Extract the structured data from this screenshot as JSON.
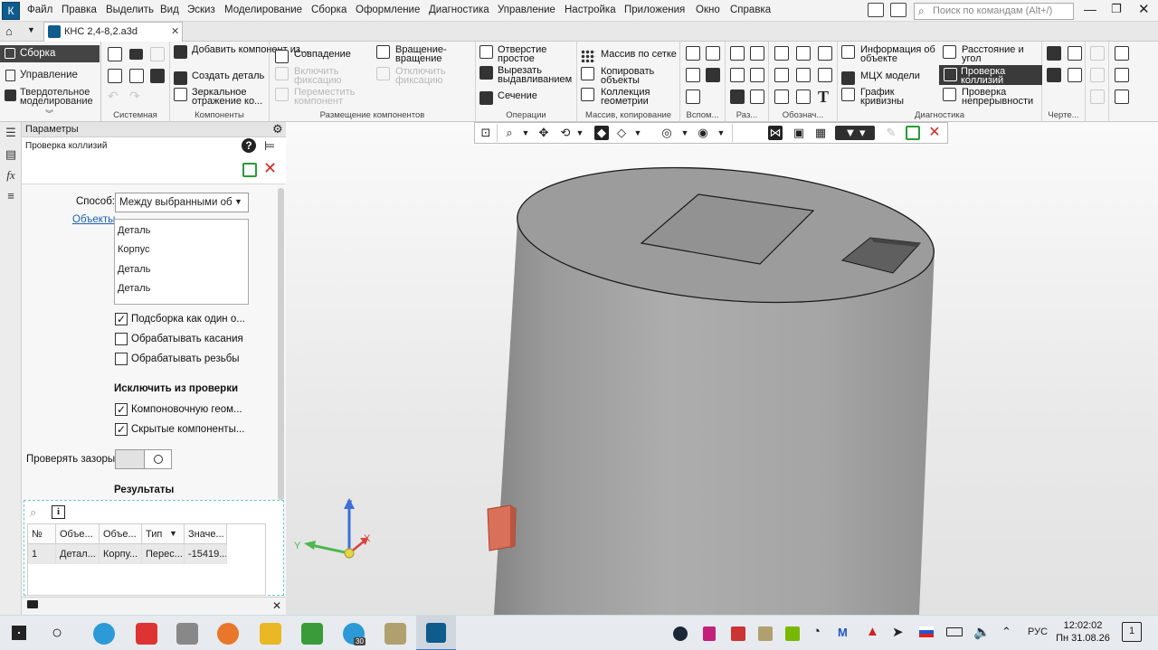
{
  "app": {
    "logo_letter": "К",
    "menu": [
      "Файл",
      "Правка",
      "Выделить",
      "Вид",
      "Эскиз",
      "Моделирование",
      "Сборка",
      "Оформление",
      "Диагностика",
      "Управление",
      "Настройка",
      "Приложения",
      "Окно",
      "Справка"
    ],
    "search_placeholder": "Поиск по командам (Alt+/)"
  },
  "tab": {
    "title": "КНС 2,4-8,2.a3d"
  },
  "ribbon": {
    "modes": [
      "Сборка",
      "Управление",
      "Твердотельное моделирование"
    ],
    "groups": {
      "system": "Системная",
      "components": "Компоненты",
      "placement": "Размещение компонентов",
      "operations": "Операции",
      "array": "Массив, копирование",
      "aux": "Вспом...",
      "sizes": "Раз...",
      "designations": "Обознач...",
      "diagnostics": "Диагностика",
      "drawing": "Черте..."
    },
    "components_items": [
      "Добавить компонент из...",
      "Создать деталь",
      "Зеркальное отражение ко..."
    ],
    "placement_items": [
      "Совпадение",
      "Включить фиксацию",
      "Переместить компонент",
      "Вращение-вращение",
      "Отключить фиксацию"
    ],
    "operations_items": [
      "Отверстие простое",
      "Вырезать выдавливанием",
      "Сечение"
    ],
    "array_items": [
      "Массив по сетке",
      "Копировать объекты",
      "Коллекция геометрии"
    ],
    "diag_items": [
      "Информация об объекте",
      "МЦХ модели",
      "График кривизны",
      "Расстояние и угол",
      "Проверка коллизий",
      "Проверка непрерывности"
    ]
  },
  "panel": {
    "header": "Параметры",
    "subtitle": "Проверка коллизий",
    "method_label": "Способ:",
    "method_value": "Между выбранными об",
    "objects_link": "Объекты",
    "objects": [
      "Деталь",
      "Корпус",
      "Деталь",
      "Деталь"
    ],
    "options": [
      {
        "label": "Подсборка как один о...",
        "checked": true
      },
      {
        "label": "Обрабатывать касания",
        "checked": false
      },
      {
        "label": "Обрабатывать резьбы",
        "checked": false
      }
    ],
    "exclude_title": "Исключить из проверки",
    "exclude": [
      {
        "label": "Компоновочную геом...",
        "checked": true
      },
      {
        "label": "Скрытые компоненты...",
        "checked": true
      }
    ],
    "gaps_label": "Проверять зазоры:",
    "results_title": "Результаты",
    "table": {
      "headers": [
        "№",
        "Объе...",
        "Объе...",
        "Тип",
        "Значе..."
      ],
      "rows": [
        [
          "1",
          "Детал...",
          "Корпу...",
          "Перес...",
          "-15419..."
        ]
      ]
    }
  },
  "viewport": {
    "axes": {
      "x": "X",
      "y": "Y",
      "z": "Z"
    }
  },
  "taskbar": {
    "lang": "РУС",
    "time": "12:02:02",
    "date": "Пн 31.08.26",
    "telegram_badge": "30",
    "notif_count": "1"
  }
}
